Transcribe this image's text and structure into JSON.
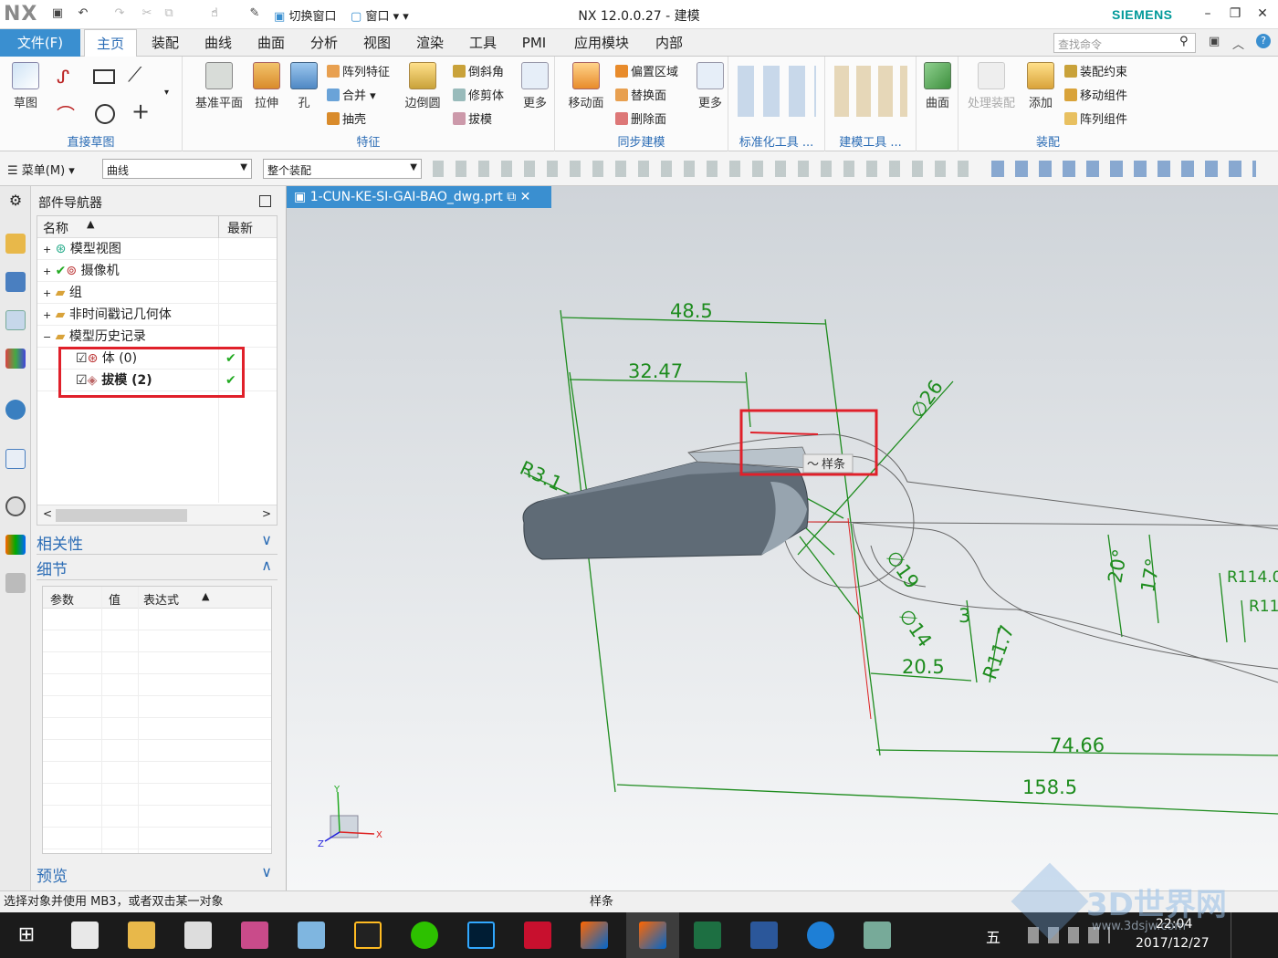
{
  "app": {
    "logo": "NX",
    "title": "NX 12.0.0.27 - 建模",
    "brand": "SIEMENS"
  },
  "quick_access": {
    "switch_window": "切换窗口",
    "window": "窗口"
  },
  "tabs": [
    "文件(F)",
    "主页",
    "装配",
    "曲线",
    "曲面",
    "分析",
    "视图",
    "渲染",
    "工具",
    "PMI",
    "应用模块",
    "内部"
  ],
  "search": {
    "placeholder": "查找命令"
  },
  "ribbon": {
    "sketch": {
      "label": "草图",
      "group": "直接草图"
    },
    "feature": {
      "datum_plane": "基准平面",
      "extrude": "拉伸",
      "hole": "孔",
      "pattern_feature": "阵列特征",
      "unite": "合并",
      "shell": "抽壳",
      "edge_blend": "边倒圆",
      "chamfer": "倒斜角",
      "trim_body": "修剪体",
      "draft": "拔模",
      "more": "更多",
      "group": "特征"
    },
    "sync": {
      "move_face": "移动面",
      "offset_region": "偏置区域",
      "replace_face": "替换面",
      "delete_face": "删除面",
      "more": "更多",
      "group": "同步建模"
    },
    "standard_tools": {
      "group": "标准化工具 ..."
    },
    "modeling_tools": {
      "group": "建模工具 ..."
    },
    "surface": {
      "label": "曲面"
    },
    "assembly": {
      "process": "处理装配",
      "add": "添加",
      "constraint": "装配约束",
      "move_component": "移动组件",
      "pattern_component": "阵列组件",
      "group": "装配"
    }
  },
  "toolbar2": {
    "menu": "菜单(M)",
    "filter": "曲线",
    "scope": "整个装配"
  },
  "navigator": {
    "title": "部件导航器",
    "col_name": "名称",
    "col_latest": "最新",
    "items": [
      {
        "label": "模型视图",
        "indent": 0
      },
      {
        "label": "摄像机",
        "indent": 0
      },
      {
        "label": "组",
        "indent": 0
      },
      {
        "label": "非时间戳记几何体",
        "indent": 0
      },
      {
        "label": "模型历史记录",
        "indent": 0
      }
    ],
    "history": [
      {
        "label": "体 (0)",
        "latest": "✔"
      },
      {
        "label": "拔模 (2)",
        "latest": "✔"
      }
    ],
    "dependencies": "相关性",
    "details": "细节",
    "detail_cols": [
      "参数",
      "值",
      "表达式"
    ],
    "preview": "预览"
  },
  "document_tab": "1-CUN-KE-SI-GAI-BAO_dwg.prt",
  "drawing": {
    "dims": [
      "48.5",
      "32.47",
      "R3.1",
      "∅26",
      "∅19",
      "∅14",
      "20.5",
      "3",
      "R11.7",
      "20°",
      "17°",
      "R114.0",
      "R11",
      "74.66",
      "158.5"
    ],
    "tooltip": "样条",
    "axes": {
      "x": "X",
      "y": "Y",
      "z": "Z"
    }
  },
  "status": {
    "prompt": "选择对象并使用 MB3，或者双击某一对象",
    "selection": "样条"
  },
  "taskbar": {
    "time": "22:04",
    "date": "2017/12/27",
    "ime": "五",
    "watermark": "3D世界网",
    "watermark_url": "www.3dsjw.com"
  },
  "colors": {
    "accent": "#3a8fd0",
    "dimension": "#1e8c1e",
    "highlight": "#e0202a",
    "model": "#5f6b76"
  }
}
